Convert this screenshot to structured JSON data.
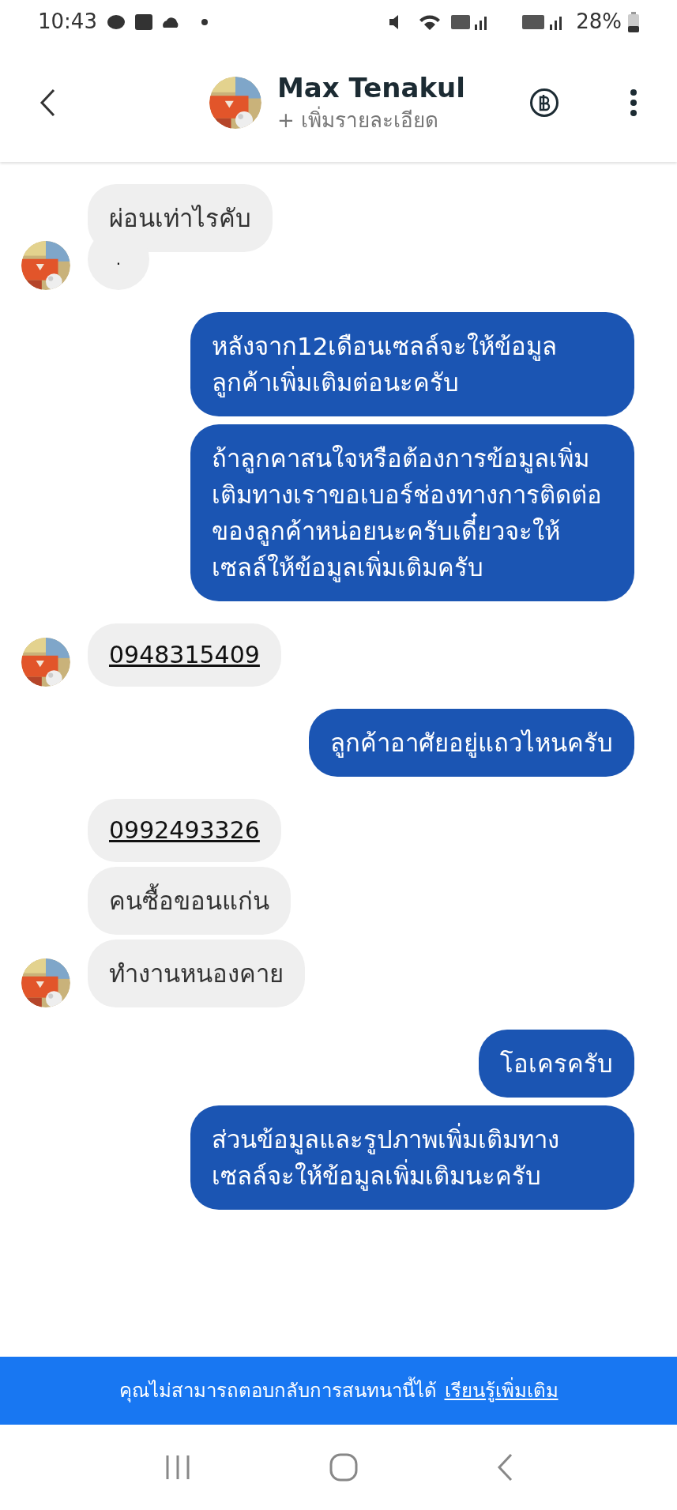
{
  "status_bar": {
    "time": "10:43",
    "battery": "28%"
  },
  "header": {
    "name": "Max Tenakul",
    "subtitle": "+ เพิ่มรายละเอียด"
  },
  "groups": [
    {
      "kind": "incoming",
      "bubbles": [
        {
          "kind": "text",
          "text": "ผ่อนเท่าไรคับ"
        },
        {
          "kind": "dot",
          "text": "."
        }
      ]
    },
    {
      "kind": "outgoing",
      "bubbles": [
        {
          "kind": "text",
          "text": "หลังจาก12เดือนเซลล์จะให้ข้อมูลลูกค้าเพิ่มเติมต่อนะครับ"
        },
        {
          "kind": "text",
          "text": "ถ้าลูกคาสนใจหรือต้องการข้อมูลเพิ่มเติมทางเราขอเบอร์ช่องทางการติดต่อของลูกค้าหน่อยนะครับเดี๋ยวจะให้เซลล์ให้ข้อมูลเพิ่มเติมครับ"
        }
      ]
    },
    {
      "kind": "incoming",
      "bubbles": [
        {
          "kind": "link",
          "text": "0948315409"
        }
      ]
    },
    {
      "kind": "outgoing",
      "bubbles": [
        {
          "kind": "text",
          "text": "ลูกค้าอาศัยอยู่แถวไหนครับ"
        }
      ]
    },
    {
      "kind": "incoming",
      "bubbles": [
        {
          "kind": "link",
          "text": "0992493326"
        },
        {
          "kind": "text",
          "text": "คนซื้อขอนแก่น"
        },
        {
          "kind": "text",
          "text": "ทำงานหนองคาย"
        }
      ]
    },
    {
      "kind": "outgoing",
      "bubbles": [
        {
          "kind": "text",
          "text": "โอเครครับ"
        },
        {
          "kind": "text",
          "text": "ส่วนข้อมูลและรูปภาพเพิ่มเติมทางเซลล์จะให้ข้อมูลเพิ่มเติมนะครับ"
        }
      ]
    }
  ],
  "banner": {
    "text": "คุณไม่สามารถตอบกลับการสนทนานี้ได้",
    "link": "เรียนรู้เพิ่มเติม"
  }
}
